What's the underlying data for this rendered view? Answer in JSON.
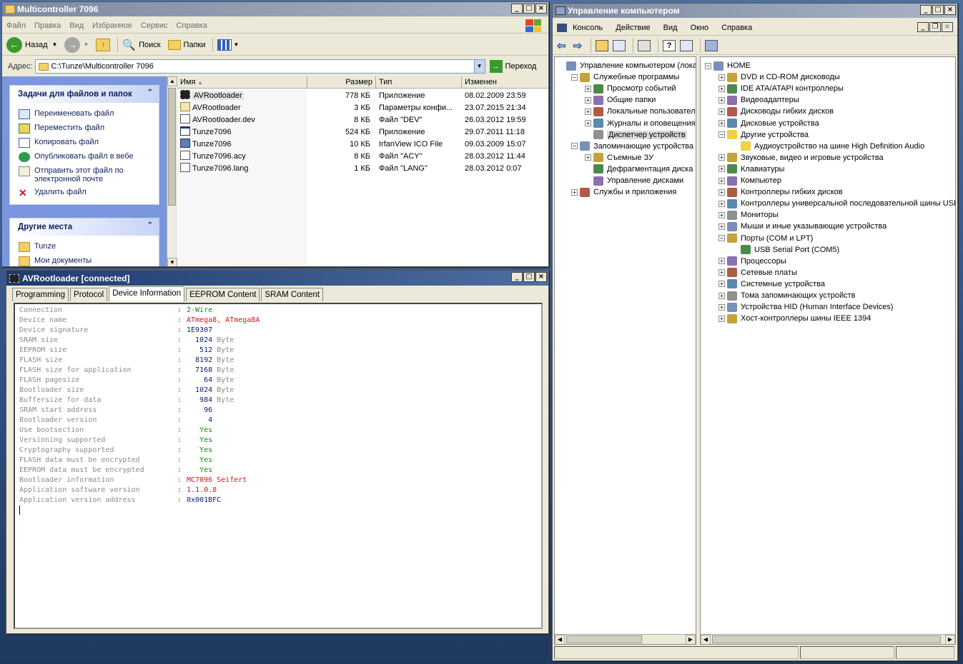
{
  "explorer": {
    "title": "Multicontroller 7096",
    "menu": [
      "Файл",
      "Правка",
      "Вид",
      "Избранное",
      "Сервис",
      "Справка"
    ],
    "toolbar": {
      "back": "Назад",
      "search": "Поиск",
      "folders": "Папки"
    },
    "address_label": "Адрес:",
    "address_value": "C:\\Tunze\\Multicontroller 7096",
    "go_label": "Переход",
    "tasks": {
      "title": "Задачи для файлов и папок",
      "items": [
        {
          "label": "Переименовать файл",
          "icon": "rename-icon"
        },
        {
          "label": "Переместить файл",
          "icon": "move-icon"
        },
        {
          "label": "Копировать файл",
          "icon": "copy-icon"
        },
        {
          "label": "Опубликовать файл в вебе",
          "icon": "web-publish-icon"
        },
        {
          "label": "Отправить этот файл по электронной почте",
          "icon": "email-icon"
        },
        {
          "label": "Удалить файл",
          "icon": "delete-icon"
        }
      ]
    },
    "places": {
      "title": "Другие места",
      "items": [
        {
          "label": "Tunze",
          "icon": "folder-icon"
        },
        {
          "label": "Мои документы",
          "icon": "documents-icon"
        }
      ]
    },
    "columns": [
      "Имя",
      "Размер",
      "Тип",
      "Изменен"
    ],
    "files": [
      {
        "name": "AVRootloader",
        "size": "778 КБ",
        "type": "Приложение",
        "modified": "08.02.2009 23:59",
        "icon": "chip-icon"
      },
      {
        "name": "AVRootloader",
        "size": "3 КБ",
        "type": "Параметры конфи...",
        "modified": "23.07.2015 21:34",
        "icon": "settings-file-icon"
      },
      {
        "name": "AVRootloader.dev",
        "size": "8 КБ",
        "type": "Файл \"DEV\"",
        "modified": "26.03.2012 19:59",
        "icon": "text-file-icon"
      },
      {
        "name": "Tunze7096",
        "size": "524 КБ",
        "type": "Приложение",
        "modified": "29.07.2011 11:18",
        "icon": "app-icon"
      },
      {
        "name": "Tunze7096",
        "size": "10 КБ",
        "type": "IrfanView ICO File",
        "modified": "09.03.2009 15:07",
        "icon": "ico-file-icon"
      },
      {
        "name": "Tunze7096.acy",
        "size": "8 КБ",
        "type": "Файл \"ACY\"",
        "modified": "28.03.2012 11:44",
        "icon": "text-file-icon"
      },
      {
        "name": "Tunze7096.lang",
        "size": "1 КБ",
        "type": "Файл \"LANG\"",
        "modified": "28.03.2012 0:07",
        "icon": "text-file-icon"
      }
    ]
  },
  "avr": {
    "title": "AVRootloader [connected]",
    "tabs": [
      "Programming",
      "Protocol",
      "Device Information",
      "EEPROM Content",
      "SRAM Content"
    ],
    "active_tab": "Device Information",
    "rows": [
      {
        "key": "Connection",
        "value": "2-Wire",
        "unit": "",
        "color": "green"
      },
      {
        "key": "Device name",
        "value": "ATmega8, ATmega8A",
        "unit": "",
        "color": "red"
      },
      {
        "key": "Device signature",
        "value": "1E9307",
        "unit": "",
        "color": "navy"
      },
      {
        "key": "SRAM size",
        "value": "  1024",
        "unit": "Byte",
        "color": "navy"
      },
      {
        "key": "EEPROM size",
        "value": "   512",
        "unit": "Byte",
        "color": "navy"
      },
      {
        "key": "FLASH size",
        "value": "  8192",
        "unit": "Byte",
        "color": "navy"
      },
      {
        "key": "FLASH size for application",
        "value": "  7168",
        "unit": "Byte",
        "color": "navy"
      },
      {
        "key": "FLASH pagesize",
        "value": "    64",
        "unit": "Byte",
        "color": "navy"
      },
      {
        "key": "Bootloader size",
        "value": "  1024",
        "unit": "Byte",
        "color": "navy"
      },
      {
        "key": "Buffersize for data",
        "value": "   984",
        "unit": "Byte",
        "color": "navy"
      },
      {
        "key": "SRAM start address",
        "value": "    96",
        "unit": "",
        "color": "navy"
      },
      {
        "key": "Bootloader version",
        "value": "     4",
        "unit": "",
        "color": "navy"
      },
      {
        "key": "Use bootsection",
        "value": "   Yes",
        "unit": "",
        "color": "green"
      },
      {
        "key": "Versioning supported",
        "value": "   Yes",
        "unit": "",
        "color": "green"
      },
      {
        "key": "Cryptography supported",
        "value": "   Yes",
        "unit": "",
        "color": "green"
      },
      {
        "key": "FLASH data must be encrypted",
        "value": "   Yes",
        "unit": "",
        "color": "green"
      },
      {
        "key": "EEPROM data must be encrypted",
        "value": "   Yes",
        "unit": "",
        "color": "green"
      },
      {
        "key": "Bootloader information",
        "value": "MC7096 Seifert",
        "unit": "",
        "color": "red"
      },
      {
        "key": "Application software version",
        "value": "1.1.0.8",
        "unit": "",
        "color": "red"
      },
      {
        "key": "Application version address",
        "value": "0x001BFC",
        "unit": "",
        "color": "navy"
      }
    ]
  },
  "mmc": {
    "title": "Управление компьютером",
    "menu": [
      "Консоль",
      "Действие",
      "Вид",
      "Окно",
      "Справка"
    ],
    "left_tree": [
      {
        "label": "Управление компьютером (локаль",
        "level": 0,
        "pm": "",
        "icon": "computer-mgmt-icon"
      },
      {
        "label": "Служебные программы",
        "level": 1,
        "pm": "-",
        "icon": "tools-icon"
      },
      {
        "label": "Просмотр событий",
        "level": 2,
        "pm": "+",
        "icon": "event-viewer-icon"
      },
      {
        "label": "Общие папки",
        "level": 2,
        "pm": "+",
        "icon": "shared-folder-icon"
      },
      {
        "label": "Локальные пользователи",
        "level": 2,
        "pm": "+",
        "icon": "users-icon"
      },
      {
        "label": "Журналы и оповещения пр",
        "level": 2,
        "pm": "+",
        "icon": "logs-icon"
      },
      {
        "label": "Диспетчер устройств",
        "level": 2,
        "pm": "",
        "icon": "device-manager-icon",
        "selected": true
      },
      {
        "label": "Запоминающие устройства",
        "level": 1,
        "pm": "-",
        "icon": "storage-icon"
      },
      {
        "label": "Съемные ЗУ",
        "level": 2,
        "pm": "+",
        "icon": "removable-icon"
      },
      {
        "label": "Дефрагментация диска",
        "level": 2,
        "pm": "",
        "icon": "defrag-icon"
      },
      {
        "label": "Управление дисками",
        "level": 2,
        "pm": "",
        "icon": "disk-mgmt-icon"
      },
      {
        "label": "Службы и приложения",
        "level": 1,
        "pm": "+",
        "icon": "services-icon"
      }
    ],
    "right_tree": [
      {
        "label": "HOME",
        "level": 0,
        "pm": "-",
        "icon": "computer-icon"
      },
      {
        "label": "DVD и CD-ROM дисководы",
        "level": 1,
        "pm": "+",
        "icon": "cdrom-icon"
      },
      {
        "label": "IDE ATA/ATAPI контроллеры",
        "level": 1,
        "pm": "+",
        "icon": "ide-icon"
      },
      {
        "label": "Видеоадаптеры",
        "level": 1,
        "pm": "+",
        "icon": "display-adapter-icon"
      },
      {
        "label": "Дисководы гибких дисков",
        "level": 1,
        "pm": "+",
        "icon": "floppy-icon"
      },
      {
        "label": "Дисковые устройства",
        "level": 1,
        "pm": "+",
        "icon": "disk-icon"
      },
      {
        "label": "Другие устройства",
        "level": 1,
        "pm": "-",
        "icon": "unknown-device-icon"
      },
      {
        "label": "Аудиоустройство на шине High Definition Audio",
        "level": 2,
        "pm": "",
        "icon": "warning-device-icon"
      },
      {
        "label": "Звуковые, видео и игровые устройства",
        "level": 1,
        "pm": "+",
        "icon": "sound-icon"
      },
      {
        "label": "Клавиатуры",
        "level": 1,
        "pm": "+",
        "icon": "keyboard-icon"
      },
      {
        "label": "Компьютер",
        "level": 1,
        "pm": "+",
        "icon": "pc-icon"
      },
      {
        "label": "Контроллеры гибких дисков",
        "level": 1,
        "pm": "+",
        "icon": "floppy-controller-icon"
      },
      {
        "label": "Контроллеры универсальной последовательной шины USB",
        "level": 1,
        "pm": "+",
        "icon": "usb-icon"
      },
      {
        "label": "Мониторы",
        "level": 1,
        "pm": "+",
        "icon": "monitor-icon"
      },
      {
        "label": "Мыши и иные указывающие устройства",
        "level": 1,
        "pm": "+",
        "icon": "mouse-icon"
      },
      {
        "label": "Порты (COM и LPT)",
        "level": 1,
        "pm": "-",
        "icon": "port-icon"
      },
      {
        "label": "USB Serial Port (COM5)",
        "level": 2,
        "pm": "",
        "icon": "serial-port-icon"
      },
      {
        "label": "Процессоры",
        "level": 1,
        "pm": "+",
        "icon": "cpu-icon"
      },
      {
        "label": "Сетевые платы",
        "level": 1,
        "pm": "+",
        "icon": "network-icon"
      },
      {
        "label": "Системные устройства",
        "level": 1,
        "pm": "+",
        "icon": "system-device-icon"
      },
      {
        "label": "Тома запоминающих устройств",
        "level": 1,
        "pm": "+",
        "icon": "volume-icon"
      },
      {
        "label": "Устройства HID (Human Interface Devices)",
        "level": 1,
        "pm": "+",
        "icon": "hid-icon"
      },
      {
        "label": "Хост-контроллеры шины IEEE 1394",
        "level": 1,
        "pm": "+",
        "icon": "ieee1394-icon"
      }
    ]
  },
  "colors": {
    "green": "#148a14",
    "red": "#d51515",
    "navy": "#0b1a7a",
    "key_grey": "#8b8b8b",
    "titlebar_active": "#1e3a6e",
    "titlebar_inactive": "#7d8aa0"
  }
}
